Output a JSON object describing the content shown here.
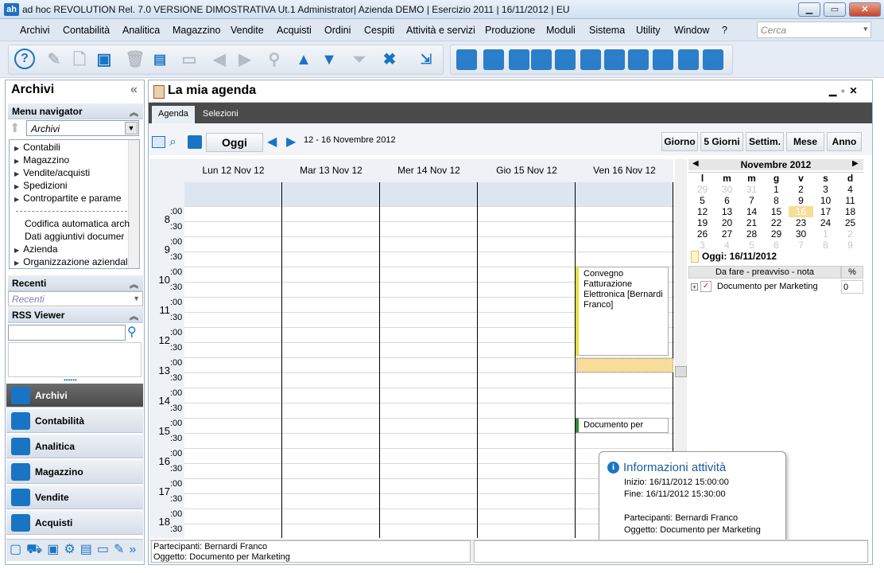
{
  "window": {
    "logo": "ah",
    "title": "ad hoc REVOLUTION Rel. 7.0 VERSIONE DIMOSTRATIVA Ut.1 Administrator| Azienda DEMO | Esercizio 2011 | 16/11/2012 | EU",
    "controls": {
      "minimize": "▁",
      "maximize": "▭",
      "close": "✕"
    }
  },
  "menu": [
    "Archivi",
    "Contabilità",
    "Analitica",
    "Magazzino",
    "Vendite",
    "Acquisti",
    "Ordini",
    "Cespiti",
    "Attività e servizi",
    "Produzione",
    "Moduli",
    "Sistema",
    "Utility",
    "Window",
    "?"
  ],
  "search": {
    "placeholder": "Cerca",
    "arrow": "▾"
  },
  "toolbar": {
    "icons": [
      "help-icon",
      "edit-icon",
      "new-record-icon",
      "save-icon",
      "delete-icon",
      "print-preview-icon",
      "print-icon",
      "previous-icon",
      "next-icon",
      "search-icon",
      "first-icon",
      "last-icon",
      "filter-icon",
      "cancel-icon",
      "expand-icon",
      "import-icon",
      "process-icon",
      "mail-icon",
      "users-icon",
      "query-icon",
      "edit-doc-icon",
      "document-icon",
      "hourglass-icon",
      "chart-icon",
      "folder-icon",
      "calendar-icon"
    ],
    "glyphs": {
      "help": "?",
      "save": "💾",
      "delete": "🗑",
      "print": "🖶",
      "prev": "◀",
      "next": "▶",
      "find": "🔍",
      "first": "▲",
      "last": "▼",
      "filter": "⏷",
      "cancel": "✖",
      "expand": "⇲"
    }
  },
  "left_panel": {
    "title": "Archivi",
    "collapse": "«",
    "menu_navigator": {
      "header": "Menu navigator",
      "combo_value": "Archivi",
      "items": [
        "Contabili",
        "Magazzino",
        "Vendite/acquisti",
        "Spedizioni",
        "Contropartite e parame",
        "Codifica automatica arch",
        "Dati aggiuntivi documer",
        "Azienda",
        "Organizzazione aziendale"
      ]
    },
    "recenti": {
      "header": "Recenti",
      "placeholder": "Recenti"
    },
    "rss": {
      "header": "RSS Viewer"
    },
    "big_nav": [
      "Archivi",
      "Contabilità",
      "Analitica",
      "Magazzino",
      "Vendite",
      "Acquisti"
    ]
  },
  "agenda": {
    "title": "La mia agenda",
    "tabs": [
      "Agenda",
      "Selezioni"
    ],
    "today_button": "Oggi",
    "date_range": "12 - 16 Novembre 2012",
    "views": [
      "Giorno",
      "5 Giorni",
      "Settim.",
      "Mese",
      "Anno"
    ],
    "days": [
      "Lun 12 Nov 12",
      "Mar 13 Nov 12",
      "Mer 14 Nov 12",
      "Gio 15 Nov 12",
      "Ven 16 Nov 12"
    ],
    "hours": [
      "8",
      "9",
      "10",
      "11",
      "12",
      "13",
      "14",
      "15",
      "16",
      "17",
      "18"
    ],
    "min_labels": [
      ":00",
      ":30"
    ],
    "events": [
      {
        "text": "Convegno Fatturazione Elettronica  [Bernardi Franco]",
        "color": "#e8e040"
      },
      {
        "text": "Documento per",
        "color": "#2e8b3a"
      }
    ]
  },
  "mini_calendar": {
    "month": "Novembre 2012",
    "weekdays": [
      "l",
      "m",
      "m",
      "g",
      "v",
      "s",
      "d"
    ],
    "weeks": [
      [
        "29",
        "30",
        "31",
        "1",
        "2",
        "3",
        "4"
      ],
      [
        "5",
        "6",
        "7",
        "8",
        "9",
        "10",
        "11"
      ],
      [
        "12",
        "13",
        "14",
        "15",
        "16",
        "17",
        "18"
      ],
      [
        "19",
        "20",
        "21",
        "22",
        "23",
        "24",
        "25"
      ],
      [
        "26",
        "27",
        "28",
        "29",
        "30",
        "1",
        "2"
      ],
      [
        "3",
        "4",
        "5",
        "6",
        "7",
        "8",
        "9"
      ]
    ],
    "today_label": "Oggi: 16/11/2012",
    "todo_header": "Da fare - preavviso - nota",
    "todo_pct_header": "%",
    "todo_items": [
      {
        "text": "Documento per Marketing",
        "pct": "0"
      }
    ]
  },
  "tooltip": {
    "title": "Informazioni attività",
    "inizio": "Inizio: 16/11/2012 15:00:00",
    "fine": "Fine: 16/11/2012 15:30:00",
    "partecipanti": "Partecipanti: Bernardi Franco",
    "oggetto": "Oggetto: Documento per Marketing"
  },
  "status": {
    "line1": "Partecipanti: Bernardi Franco",
    "line2": "Oggetto: Documento per Marketing"
  }
}
